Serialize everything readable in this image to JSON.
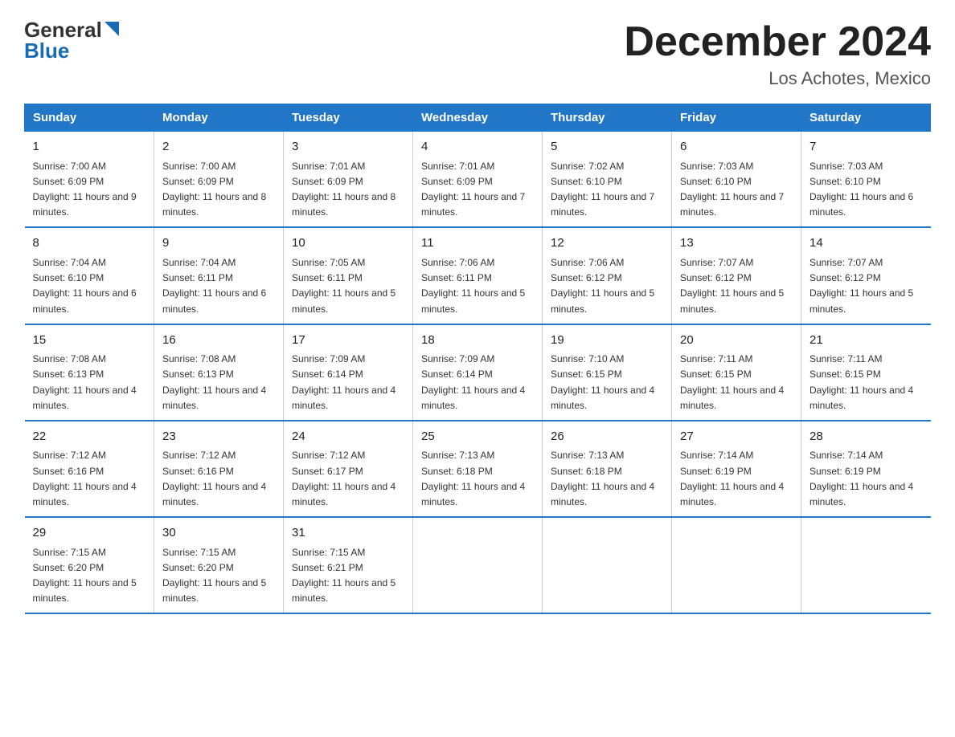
{
  "logo": {
    "general": "General",
    "blue": "Blue",
    "arrow_color": "#1a6bb5"
  },
  "header": {
    "title": "December 2024",
    "subtitle": "Los Achotes, Mexico"
  },
  "columns": [
    "Sunday",
    "Monday",
    "Tuesday",
    "Wednesday",
    "Thursday",
    "Friday",
    "Saturday"
  ],
  "weeks": [
    [
      {
        "day": "1",
        "sunrise": "7:00 AM",
        "sunset": "6:09 PM",
        "daylight": "11 hours and 9 minutes."
      },
      {
        "day": "2",
        "sunrise": "7:00 AM",
        "sunset": "6:09 PM",
        "daylight": "11 hours and 8 minutes."
      },
      {
        "day": "3",
        "sunrise": "7:01 AM",
        "sunset": "6:09 PM",
        "daylight": "11 hours and 8 minutes."
      },
      {
        "day": "4",
        "sunrise": "7:01 AM",
        "sunset": "6:09 PM",
        "daylight": "11 hours and 7 minutes."
      },
      {
        "day": "5",
        "sunrise": "7:02 AM",
        "sunset": "6:10 PM",
        "daylight": "11 hours and 7 minutes."
      },
      {
        "day": "6",
        "sunrise": "7:03 AM",
        "sunset": "6:10 PM",
        "daylight": "11 hours and 7 minutes."
      },
      {
        "day": "7",
        "sunrise": "7:03 AM",
        "sunset": "6:10 PM",
        "daylight": "11 hours and 6 minutes."
      }
    ],
    [
      {
        "day": "8",
        "sunrise": "7:04 AM",
        "sunset": "6:10 PM",
        "daylight": "11 hours and 6 minutes."
      },
      {
        "day": "9",
        "sunrise": "7:04 AM",
        "sunset": "6:11 PM",
        "daylight": "11 hours and 6 minutes."
      },
      {
        "day": "10",
        "sunrise": "7:05 AM",
        "sunset": "6:11 PM",
        "daylight": "11 hours and 5 minutes."
      },
      {
        "day": "11",
        "sunrise": "7:06 AM",
        "sunset": "6:11 PM",
        "daylight": "11 hours and 5 minutes."
      },
      {
        "day": "12",
        "sunrise": "7:06 AM",
        "sunset": "6:12 PM",
        "daylight": "11 hours and 5 minutes."
      },
      {
        "day": "13",
        "sunrise": "7:07 AM",
        "sunset": "6:12 PM",
        "daylight": "11 hours and 5 minutes."
      },
      {
        "day": "14",
        "sunrise": "7:07 AM",
        "sunset": "6:12 PM",
        "daylight": "11 hours and 5 minutes."
      }
    ],
    [
      {
        "day": "15",
        "sunrise": "7:08 AM",
        "sunset": "6:13 PM",
        "daylight": "11 hours and 4 minutes."
      },
      {
        "day": "16",
        "sunrise": "7:08 AM",
        "sunset": "6:13 PM",
        "daylight": "11 hours and 4 minutes."
      },
      {
        "day": "17",
        "sunrise": "7:09 AM",
        "sunset": "6:14 PM",
        "daylight": "11 hours and 4 minutes."
      },
      {
        "day": "18",
        "sunrise": "7:09 AM",
        "sunset": "6:14 PM",
        "daylight": "11 hours and 4 minutes."
      },
      {
        "day": "19",
        "sunrise": "7:10 AM",
        "sunset": "6:15 PM",
        "daylight": "11 hours and 4 minutes."
      },
      {
        "day": "20",
        "sunrise": "7:11 AM",
        "sunset": "6:15 PM",
        "daylight": "11 hours and 4 minutes."
      },
      {
        "day": "21",
        "sunrise": "7:11 AM",
        "sunset": "6:15 PM",
        "daylight": "11 hours and 4 minutes."
      }
    ],
    [
      {
        "day": "22",
        "sunrise": "7:12 AM",
        "sunset": "6:16 PM",
        "daylight": "11 hours and 4 minutes."
      },
      {
        "day": "23",
        "sunrise": "7:12 AM",
        "sunset": "6:16 PM",
        "daylight": "11 hours and 4 minutes."
      },
      {
        "day": "24",
        "sunrise": "7:12 AM",
        "sunset": "6:17 PM",
        "daylight": "11 hours and 4 minutes."
      },
      {
        "day": "25",
        "sunrise": "7:13 AM",
        "sunset": "6:18 PM",
        "daylight": "11 hours and 4 minutes."
      },
      {
        "day": "26",
        "sunrise": "7:13 AM",
        "sunset": "6:18 PM",
        "daylight": "11 hours and 4 minutes."
      },
      {
        "day": "27",
        "sunrise": "7:14 AM",
        "sunset": "6:19 PM",
        "daylight": "11 hours and 4 minutes."
      },
      {
        "day": "28",
        "sunrise": "7:14 AM",
        "sunset": "6:19 PM",
        "daylight": "11 hours and 4 minutes."
      }
    ],
    [
      {
        "day": "29",
        "sunrise": "7:15 AM",
        "sunset": "6:20 PM",
        "daylight": "11 hours and 5 minutes."
      },
      {
        "day": "30",
        "sunrise": "7:15 AM",
        "sunset": "6:20 PM",
        "daylight": "11 hours and 5 minutes."
      },
      {
        "day": "31",
        "sunrise": "7:15 AM",
        "sunset": "6:21 PM",
        "daylight": "11 hours and 5 minutes."
      },
      null,
      null,
      null,
      null
    ]
  ]
}
